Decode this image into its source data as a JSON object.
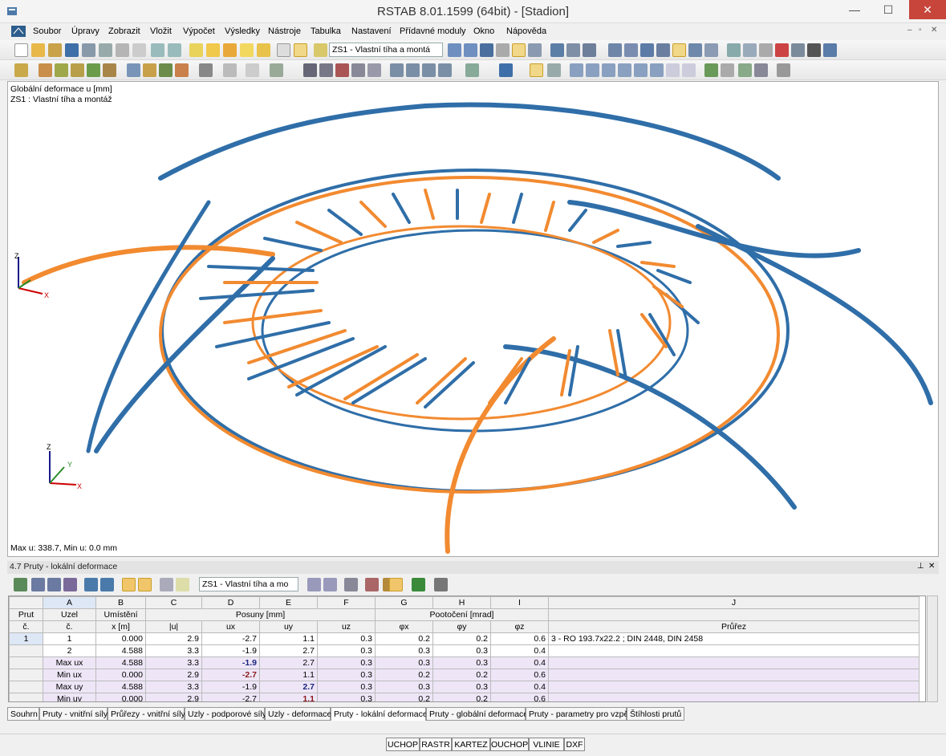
{
  "window": {
    "title": "RSTAB 8.01.1599 (64bit) - [Stadion]",
    "minimize": "—",
    "maximize": "☐",
    "close": "✕"
  },
  "menu": {
    "items": [
      "Soubor",
      "Úpravy",
      "Zobrazit",
      "Vložit",
      "Výpočet",
      "Výsledky",
      "Nástroje",
      "Tabulka",
      "Nastavení",
      "Přídavné moduly",
      "Okno",
      "Nápověda"
    ],
    "mdi": [
      "–",
      "▫",
      "✕"
    ]
  },
  "toolbar": {
    "loadcase": "ZS1 - Vlastní tíha a montá"
  },
  "viewport": {
    "info_line1": "Globální deformace u [mm]",
    "info_line2": "ZS1 : Vlastní tíha a montáž",
    "maxmin": "Max u: 338.7, Min u: 0.0 mm",
    "axis_x": "X",
    "axis_y": "Y",
    "axis_z": "Z",
    "colors": {
      "deformed": "#f28a30",
      "undeformed": "#2f6ea8"
    }
  },
  "panel": {
    "title": "4.7 Pruty - lokální deformace",
    "pin": "⊥",
    "close": "✕",
    "loadcase": "ZS1 - Vlastní tíha a mo",
    "cols": [
      "A",
      "B",
      "C",
      "D",
      "E",
      "F",
      "G",
      "H",
      "I",
      "J"
    ],
    "hdr_prut1": "Prut",
    "hdr_prut2": "č.",
    "hdr_uzel1": "Uzel",
    "hdr_uzel2": "č.",
    "hdr_umist1": "Umístění",
    "hdr_umist2": "x [m]",
    "hdr_posuny": "Posuny [mm]",
    "hdr_u": "|u|",
    "hdr_ux": "ux",
    "hdr_uy": "uy",
    "hdr_uz": "uz",
    "hdr_pootoceni": "Pootočení [mrad]",
    "hdr_px": "φx",
    "hdr_py": "φy",
    "hdr_pz": "φz",
    "hdr_prurez": "Průřez",
    "prut_no": "1",
    "rows": [
      {
        "uzel": "1",
        "x": "0.000",
        "u": "2.9",
        "ux": "-2.7",
        "uy": "1.1",
        "uz": "0.3",
        "px": "0.2",
        "py": "0.2",
        "pz": "0.6",
        "prurez": "3 - RO 193.7x22.2 ; DIN 2448, DIN 2458"
      },
      {
        "uzel": "2",
        "x": "4.588",
        "u": "3.3",
        "ux": "-1.9",
        "uy": "2.7",
        "uz": "0.3",
        "px": "0.3",
        "py": "0.3",
        "pz": "0.4",
        "prurez": ""
      },
      {
        "uzel": "Max ux",
        "x": "4.588",
        "u": "3.3",
        "ux": "-1.9",
        "uy": "2.7",
        "uz": "0.3",
        "px": "0.3",
        "py": "0.3",
        "pz": "0.4",
        "prurez": ""
      },
      {
        "uzel": "Min ux",
        "x": "0.000",
        "u": "2.9",
        "ux": "-2.7",
        "uy": "1.1",
        "uz": "0.3",
        "px": "0.2",
        "py": "0.2",
        "pz": "0.6",
        "prurez": ""
      },
      {
        "uzel": "Max uy",
        "x": "4.588",
        "u": "3.3",
        "ux": "-1.9",
        "uy": "2.7",
        "uz": "0.3",
        "px": "0.3",
        "py": "0.3",
        "pz": "0.4",
        "prurez": ""
      },
      {
        "uzel": "Min uy",
        "x": "0.000",
        "u": "2.9",
        "ux": "-2.7",
        "uy": "1.1",
        "uz": "0.3",
        "px": "0.2",
        "py": "0.2",
        "pz": "0.6",
        "prurez": ""
      }
    ]
  },
  "tabs": [
    "Souhrn",
    "Pruty - vnitřní síly",
    "Průřezy - vnitřní síly",
    "Uzly - podporové síly",
    "Uzly - deformace",
    "Pruty - lokální deformace",
    "Pruty - globální deformace",
    "Pruty - parametry pro vzpěr",
    "Štíhlosti prutů"
  ],
  "status": [
    "UCHOP",
    "RASTR",
    "KARTEZ",
    "OUCHOP",
    "VLINIE",
    "DXF"
  ]
}
